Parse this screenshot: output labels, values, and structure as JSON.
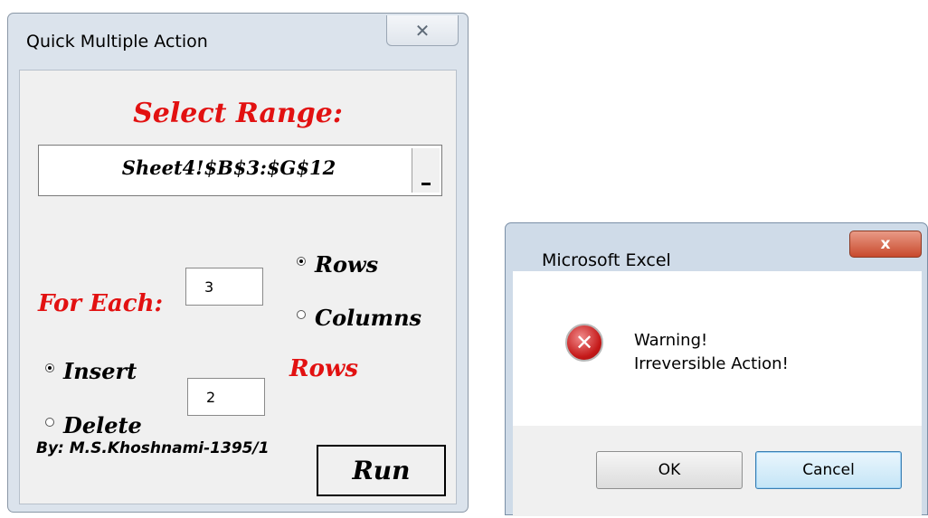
{
  "userform": {
    "title": "Quick Multiple Action",
    "close_glyph": "✕",
    "heading": "Select Range:",
    "range_value": "Sheet4!$B$3:$G$12",
    "for_each_label": "For Each:",
    "for_each_value": "3",
    "target_options": [
      {
        "label": "Rows",
        "selected": true
      },
      {
        "label": "Columns",
        "selected": false
      }
    ],
    "action_options": [
      {
        "label": "Insert",
        "selected": true
      },
      {
        "label": "Delete",
        "selected": false
      }
    ],
    "count_value": "2",
    "count_unit_label": "Rows",
    "author": "By: M.S.Khoshnami-1395/1",
    "run_label": "Run",
    "accent_color": "#e21111"
  },
  "messagebox": {
    "title": "Microsoft Excel",
    "close_glyph": "x",
    "message_line1": "Warning!",
    "message_line2": "Irreversible Action!",
    "icon": "error-icon",
    "ok_label": "OK",
    "cancel_label": "Cancel"
  }
}
